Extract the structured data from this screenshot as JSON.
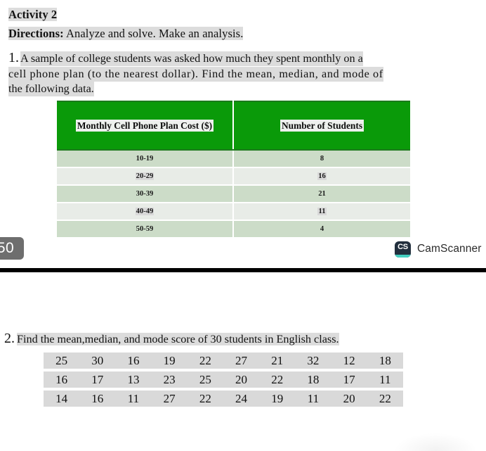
{
  "page_one": {
    "activity_title": "Activity 2",
    "directions_label": "Directions:",
    "directions_text": " Analyze and solve. Make an analysis.",
    "question_number": "1.",
    "question_line_1": "A sample of college students was asked how much they spent monthly on a",
    "question_line_2": "cell phone plan (to the nearest dollar). Find the mean, median, and mode of",
    "question_line_3": "the following data.",
    "table": {
      "headers": [
        "Monthly Cell Phone Plan Cost ($)",
        "Number of Students"
      ],
      "rows": [
        [
          "10-19",
          "8"
        ],
        [
          "20-29",
          "16"
        ],
        [
          "30-39",
          "21"
        ],
        [
          "40-49",
          "11"
        ],
        [
          "50-59",
          "4"
        ]
      ]
    },
    "page_badge": "50",
    "watermark": {
      "mark_text": "CS",
      "word": "CamScanner"
    }
  },
  "page_two": {
    "question_number": "2.",
    "question_text": "Find the mean,median, and mode score of 30 students in English class.",
    "scores": [
      [
        "25",
        "30",
        "16",
        "19",
        "22",
        "27",
        "21",
        "32",
        "12",
        "18"
      ],
      [
        "16",
        "17",
        "13",
        "23",
        "25",
        "20",
        "22",
        "18",
        "17",
        "11"
      ],
      [
        "14",
        "16",
        "11",
        "27",
        "22",
        "24",
        "19",
        "11",
        "20",
        "22"
      ]
    ]
  },
  "colors": {
    "table_header_green": "#0a9a09",
    "row_tint_dark": "#ccdcc8",
    "row_tint_light": "#e8ece7",
    "highlight_gray": "#dcdcdc",
    "badge_gray": "#6e6e6e",
    "camscanner_navy": "#222f3d",
    "camscanner_teal": "#45cfc0"
  }
}
